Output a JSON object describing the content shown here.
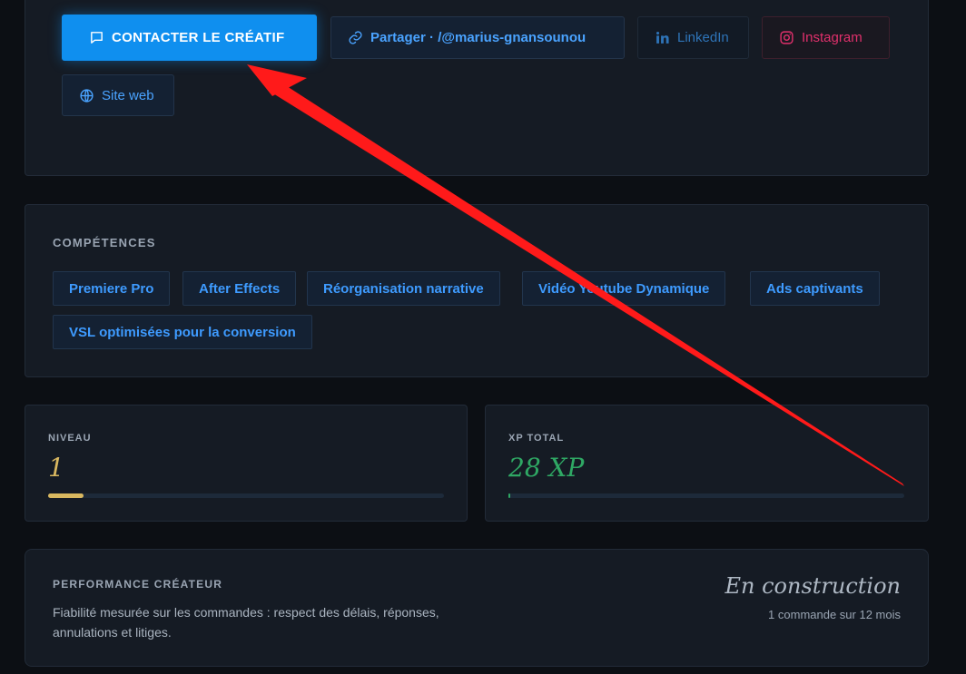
{
  "actions": {
    "contact_label": "CONTACTER LE CRÉATIF",
    "share_label": "Partager · /@marius-gnansounou",
    "linkedin_label": "LinkedIn",
    "instagram_label": "Instagram",
    "website_label": "Site web",
    "icons": [
      "message-icon",
      "link-icon",
      "linkedin-icon",
      "instagram-icon",
      "globe-icon"
    ]
  },
  "skills": {
    "title": "COMPÉTENCES",
    "items": [
      "Premiere Pro",
      "After Effects",
      "Réorganisation narrative",
      "Vidéo Youtube Dynamique",
      "Ads captivants",
      "VSL optimisées pour la conversion"
    ]
  },
  "level": {
    "label": "NIVEAU",
    "value": "1",
    "progress": 0.09
  },
  "xp": {
    "label": "XP TOTAL",
    "value": "28 XP",
    "progress": 0.005
  },
  "performance": {
    "title": "PERFORMANCE CRÉATEUR",
    "description": "Fiabilité mesurée sur les commandes : respect des délais, réponses, annulations et litiges.",
    "status": "En construction",
    "count": "1 commande sur 12 mois"
  },
  "colors": {
    "accent": "#0f8fef",
    "tag_text": "#3e9bff",
    "level": "#d9b860",
    "xp": "#2fa864",
    "instagram": "#e1306c",
    "annotation_arrow": "#ff1a1a"
  }
}
